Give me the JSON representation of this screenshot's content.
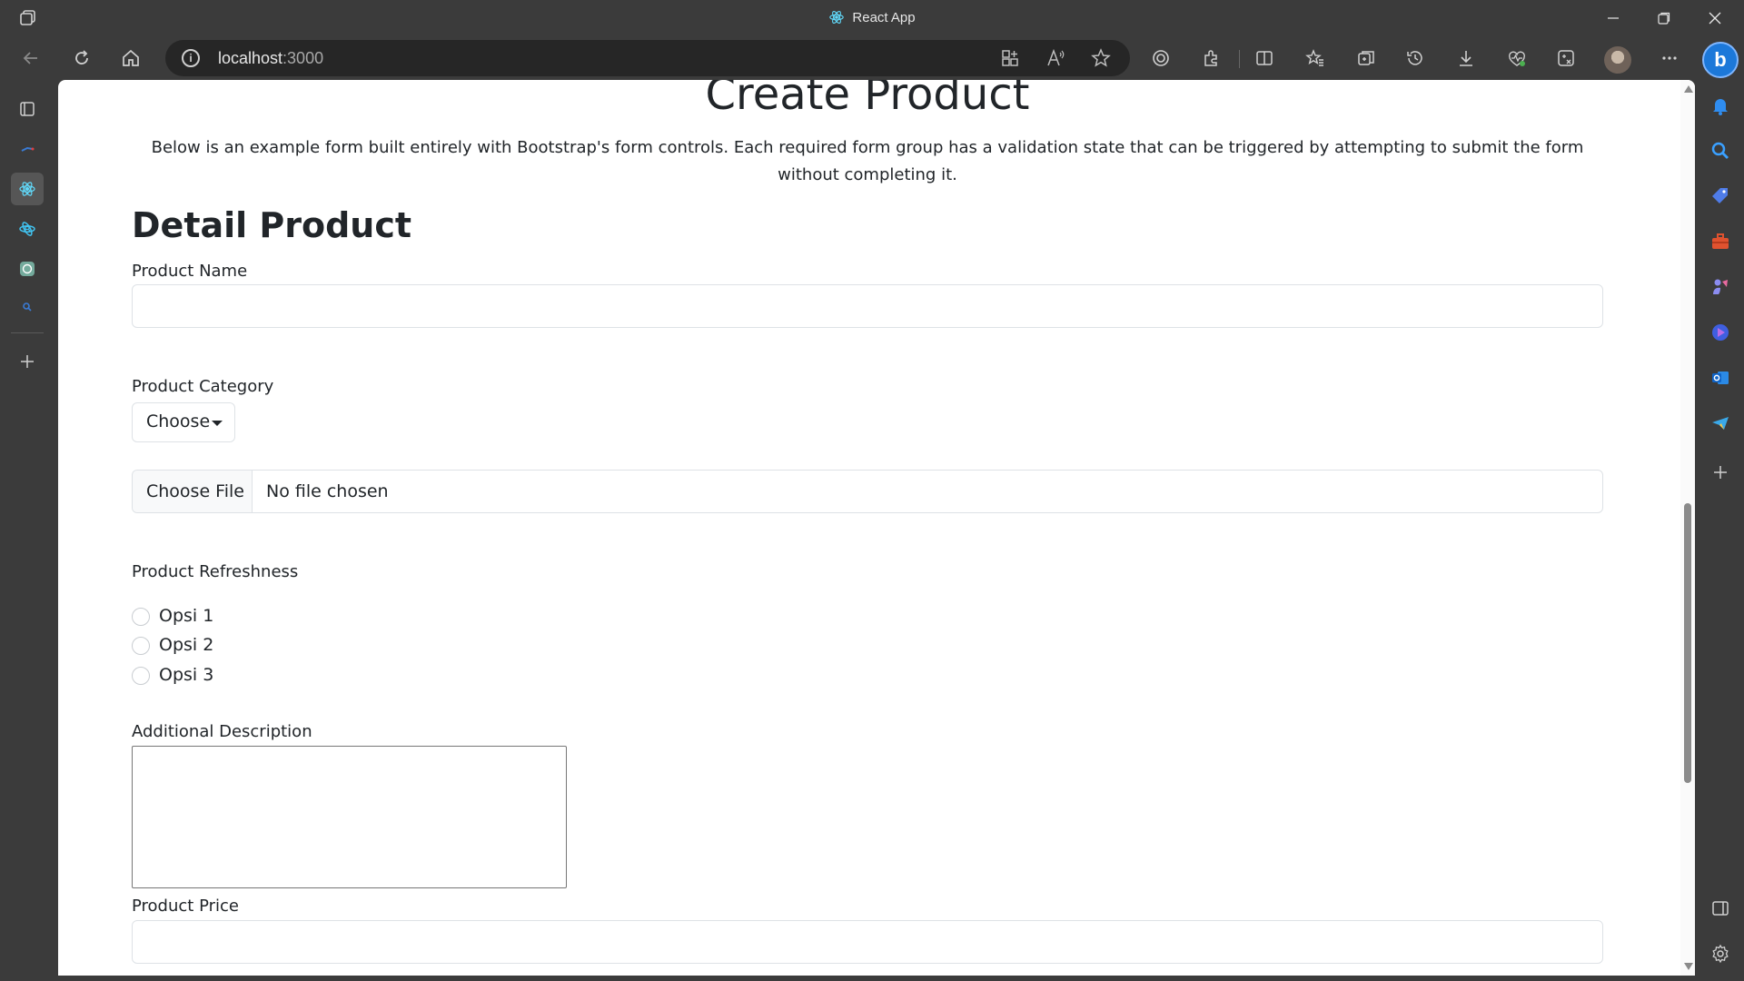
{
  "window": {
    "title": "React App",
    "controls": [
      "minimize",
      "restore",
      "close"
    ]
  },
  "browser": {
    "url_host": "localhost",
    "url_port": ":3000",
    "toolbar_icons": [
      "back-icon",
      "refresh-icon",
      "home-icon",
      "app-available-icon",
      "read-aloud-icon",
      "favorite-star-icon",
      "tracking-icon",
      "extensions-icon",
      "split-screen-icon",
      "favorites-icon",
      "collections-icon",
      "history-icon",
      "downloads-icon",
      "performance-icon",
      "math-solver-icon",
      "profile-avatar",
      "more-icon",
      "copilot-icon"
    ]
  },
  "sidebar_left": {
    "items": [
      "tab-actions-icon",
      "tab-generic",
      "tab-react-app",
      "tab-react-bootstrap",
      "tab-chatgpt",
      "tab-search",
      "new-tab-icon"
    ]
  },
  "sidebar_right": {
    "items": [
      "notifications-icon",
      "search-icon",
      "shopping-icon",
      "tools-icon",
      "games-icon",
      "copilot-app-icon",
      "outlook-icon",
      "telegram-icon",
      "add-icon",
      "sidebar-toggle-icon",
      "settings-icon"
    ]
  },
  "page": {
    "title": "Create Product",
    "description": "Below is an example form built entirely with Bootstrap's form controls. Each required form group has a validation state that can be triggered by attempting to submit the form without completing it.",
    "section_title": "Detail Product",
    "product_name_label": "Product Name",
    "product_name_value": "",
    "product_category_label": "Product Category",
    "category_dropdown_label": "Choose",
    "file_button_label": "Choose File",
    "file_status": "No file chosen",
    "refreshness_label": "Product Refreshness",
    "refreshness_options": [
      "Opsi 1",
      "Opsi 2",
      "Opsi 3"
    ],
    "additional_description_label": "Additional Description",
    "additional_description_value": "",
    "product_price_label": "Product Price",
    "product_price_value": ""
  },
  "colors": {
    "browser_chrome": "#3b3b3b",
    "address_bar": "#262626",
    "page_background": "#ffffff",
    "text": "#212529",
    "input_border": "#dee2e6",
    "accent_blue": "#1c78d9"
  }
}
